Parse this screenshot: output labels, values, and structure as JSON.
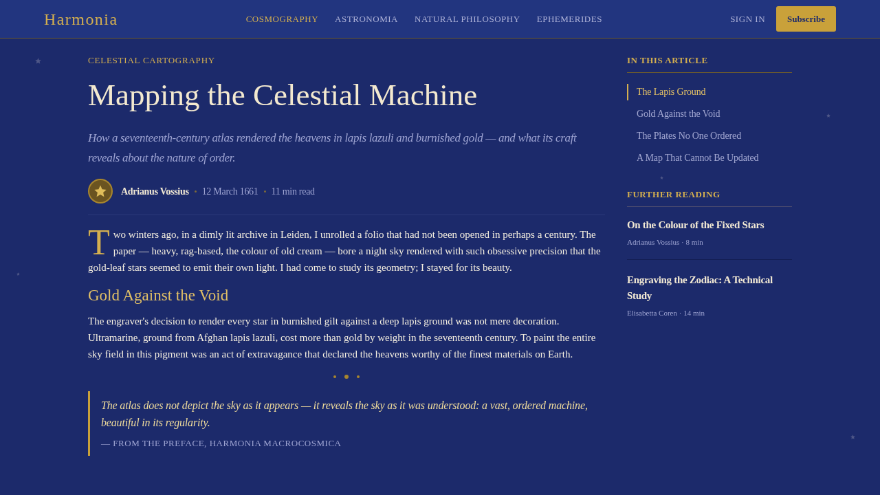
{
  "header": {
    "logo": "Harmonia",
    "nav": [
      {
        "label": "COSMOGRAPHY",
        "selected": true
      },
      {
        "label": "ASTRONOMIA",
        "selected": false
      },
      {
        "label": "NATURAL PHILOSOPHY",
        "selected": false
      },
      {
        "label": "EPHEMERIDES",
        "selected": false
      }
    ],
    "sign_in": "SIGN IN",
    "subscribe": "Subscribe"
  },
  "article": {
    "kicker": "CELESTIAL CARTOGRAPHY",
    "title": "Mapping the Celestial Machine",
    "subtitle": "How a seventeenth-century atlas rendered the heavens in lapis lazuli and burnished gold — and what its craft reveals about the nature of order.",
    "byline": {
      "author": "Adrianus Vossius",
      "date": "12 March 1661",
      "read_time": "11 min read"
    },
    "body": [
      {
        "kind": "paragraph",
        "drop_cap": true,
        "text": "Two winters ago, in a dimly lit archive in Leiden, I unrolled a folio that had not been opened in perhaps a century. The paper — heavy, rag-based, the colour of old cream — bore a night sky rendered with such obsessive precision that the gold-leaf stars seemed to emit their own light. I had come to study its geometry; I stayed for its beauty."
      },
      {
        "kind": "heading",
        "text": "Gold Against the Void"
      },
      {
        "kind": "paragraph",
        "drop_cap": false,
        "text": "The engraver's decision to render every star in burnished gilt against a deep lapis ground was not mere decoration. Ultramarine, ground from Afghan lapis lazuli, cost more than gold by weight in the seventeenth century. To paint the entire sky field in this pigment was an act of extravagance that declared the heavens worthy of the finest materials on Earth."
      },
      {
        "kind": "ornament"
      },
      {
        "kind": "quote",
        "text": "The atlas does not depict the sky as it appears — it reveals the sky as it was understood: a vast, ordered machine, beautiful in its regularity.",
        "attribution": "— FROM THE PREFACE, HARMONIA MACROCOSMICA"
      }
    ]
  },
  "sidebar": {
    "toc": {
      "title": "IN THIS ARTICLE",
      "items": [
        {
          "label": "The Lapis Ground",
          "selected": true
        },
        {
          "label": "Gold Against the Void",
          "selected": false
        },
        {
          "label": "The Plates No One Ordered",
          "selected": false
        },
        {
          "label": "A Map That Cannot Be Updated",
          "selected": false
        }
      ]
    },
    "further_reading": {
      "title": "FURTHER READING",
      "items": [
        {
          "title": "On the Colour of the Fixed Stars",
          "meta": "Adrianus Vossius · 8 min"
        },
        {
          "title": "Engraving the Zodiac: A Technical Study",
          "meta": "Elisabetta Coren · 14 min"
        }
      ]
    }
  }
}
